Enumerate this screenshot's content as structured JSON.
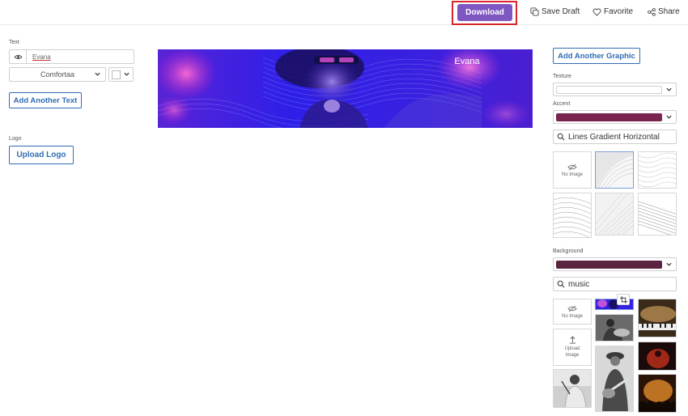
{
  "toolbar": {
    "download_label": "Download",
    "save_draft_label": "Save Draft",
    "favorite_label": "Favorite",
    "share_label": "Share"
  },
  "left_panel": {
    "text_section_label": "Text",
    "text_value": "Evana",
    "font_value": "Comfortaa",
    "add_text_label": "Add Another Text",
    "logo_section_label": "Logo",
    "upload_logo_label": "Upload Logo"
  },
  "banner": {
    "title": "Evana"
  },
  "right_panel": {
    "add_graphic_label": "Add Another Graphic",
    "texture_label": "Texture",
    "accent_label": "Accent",
    "texture_search_value": "Lines Gradient Horizontal",
    "no_image_label": "No Image",
    "background_label": "Background",
    "background_search_value": "music",
    "upload_image_label": "Upload Image"
  },
  "colors": {
    "primary_button": "#7e57c2",
    "highlight_border": "#d9252b",
    "outline_blue": "#2f6db5",
    "accent_swatch": "#7a2550",
    "background_swatch": "#5a2440",
    "banner_base": "#3b1de0"
  },
  "icons": [
    "copy-icon",
    "heart-icon",
    "share-icon",
    "eye-icon",
    "chevron-down-icon",
    "search-icon",
    "no-image-icon",
    "upload-icon",
    "crop-icon"
  ]
}
